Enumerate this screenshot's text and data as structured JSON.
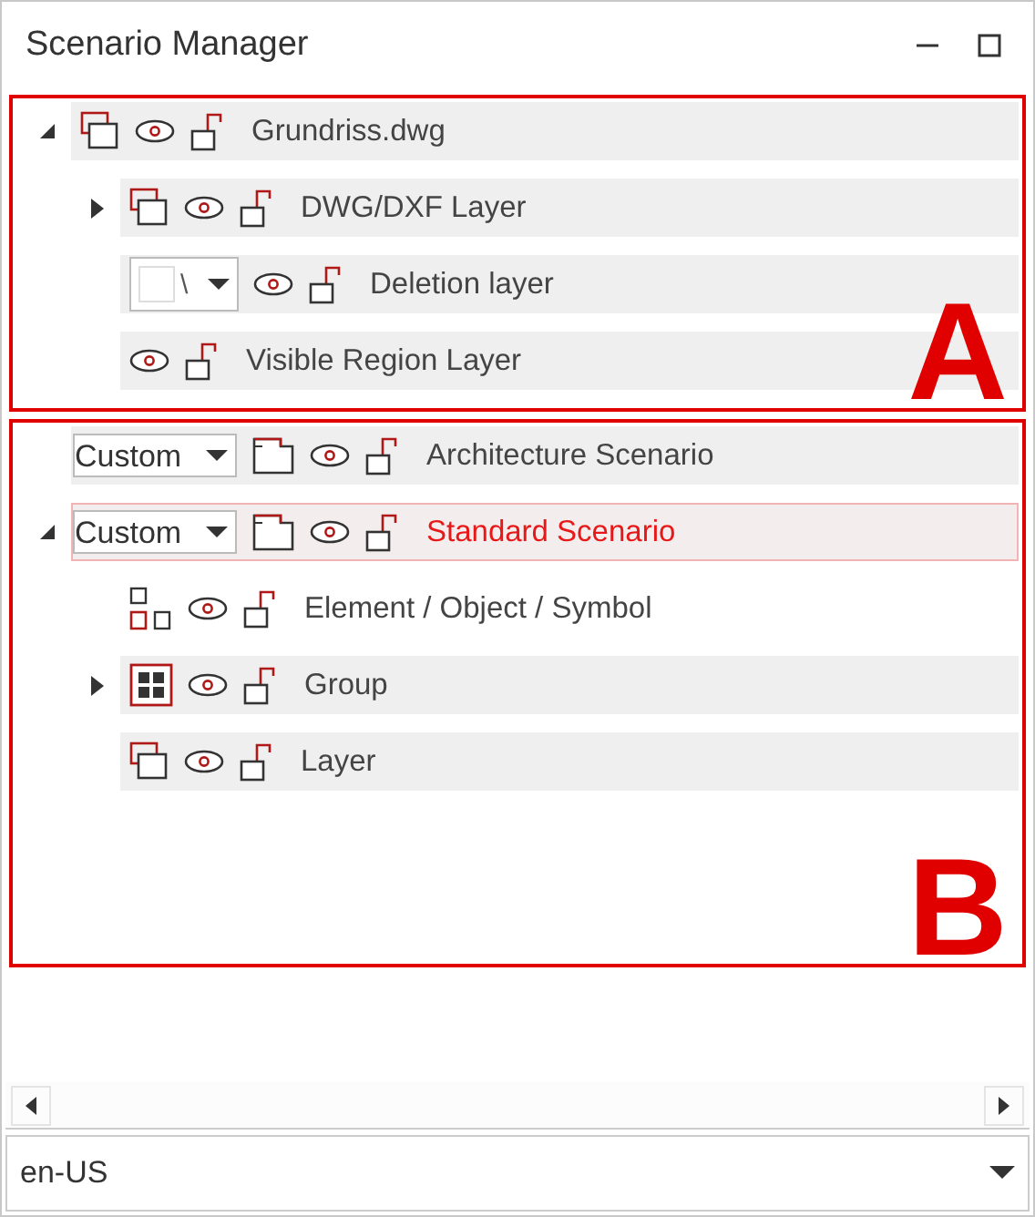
{
  "window": {
    "title": "Scenario Manager"
  },
  "regions": [
    {
      "label": "A",
      "rows": [
        {
          "label": "Grundriss.dwg",
          "kind": "layers",
          "expanded": true,
          "shaded": true,
          "selected": false,
          "children": [
            {
              "label": "DWG/DXF Layer",
              "kind": "layers",
              "expanded": false,
              "shaded": true,
              "selected": false
            },
            {
              "label": "Deletion layer",
              "kind": "plain",
              "combo": {
                "kind": "swatch",
                "text": "\\"
              },
              "shaded": true,
              "selected": false
            },
            {
              "label": "Visible Region Layer",
              "kind": "plain",
              "shaded": true,
              "selected": false
            }
          ]
        }
      ]
    },
    {
      "label": "B",
      "rows": [
        {
          "label": "Architecture Scenario",
          "kind": "folder",
          "combo": {
            "kind": "text",
            "text": "Custom"
          },
          "shaded": true,
          "selected": false
        },
        {
          "label": "Standard Scenario",
          "kind": "folder",
          "combo": {
            "kind": "text",
            "text": "Custom"
          },
          "expanded": true,
          "selected": true,
          "children": [
            {
              "label": "Element / Object / Symbol",
              "kind": "elements",
              "shaded": false,
              "selected": false
            },
            {
              "label": "Group",
              "kind": "group",
              "expanded": false,
              "shaded": true,
              "selected": false
            },
            {
              "label": "Layer",
              "kind": "layers",
              "shaded": true,
              "selected": false
            }
          ]
        }
      ]
    }
  ],
  "language_select": {
    "value": "en-US"
  }
}
